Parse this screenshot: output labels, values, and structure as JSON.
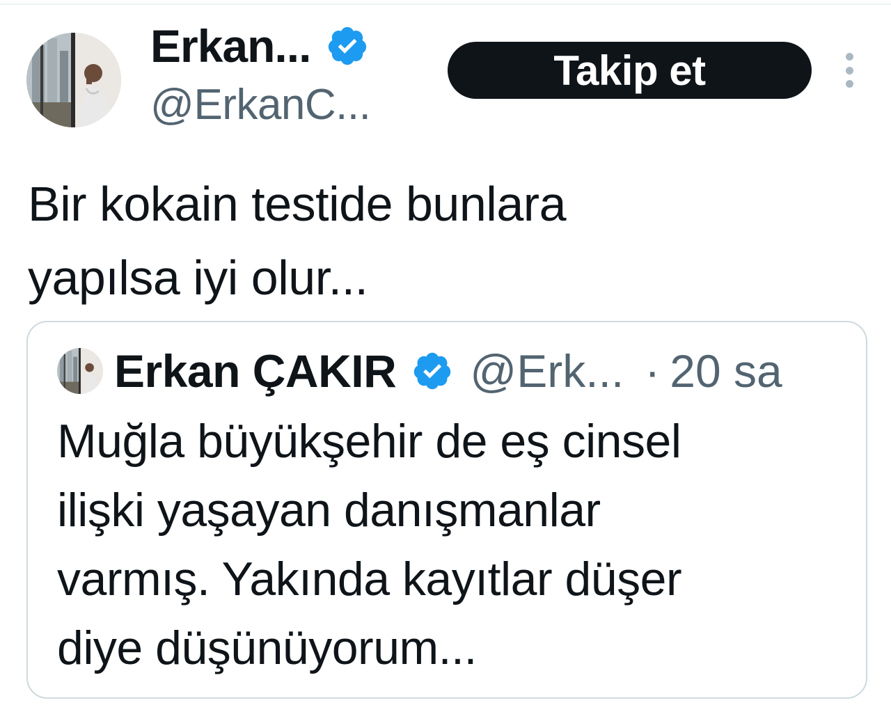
{
  "tweet": {
    "author": {
      "display_name": "Erkan...",
      "handle": "@ErkanC...",
      "verified_icon": "verified-badge-icon"
    },
    "follow_label": "Takip et",
    "more_icon": "more-options-icon",
    "text": "Bir kokain testide bunlara\nyapılsa iyi olur..."
  },
  "quote": {
    "author": {
      "display_name": "Erkan ÇAKIR",
      "handle": "@Erk...",
      "separator": "·",
      "time": "20 sa",
      "verified_icon": "verified-badge-icon"
    },
    "text": "Muğla büyükşehir de eş cinsel\nilişki yaşayan danışmanlar\nvarmış. Yakında kayıtlar düşer\ndiye düşünüyorum..."
  },
  "colors": {
    "text_primary": "#0f1419",
    "text_secondary": "#536471",
    "verified_blue": "#1d9bf0",
    "button_background": "#0f1419",
    "button_text": "#ffffff",
    "card_border": "#cfd9de"
  }
}
